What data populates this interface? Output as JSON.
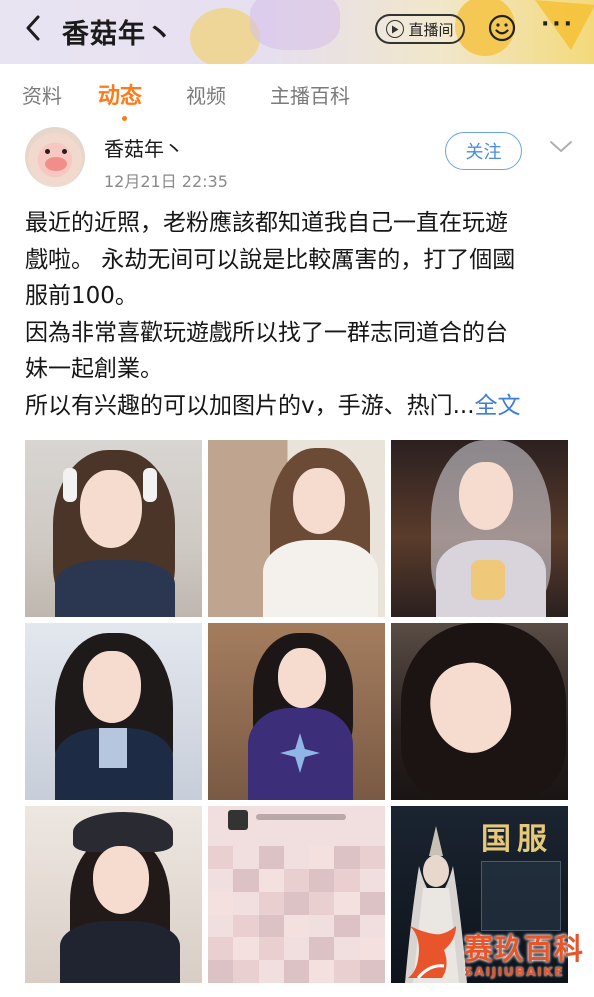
{
  "header": {
    "back_icon": "chevron-left-icon",
    "title": "香菇年丶",
    "live_button_label": "直播间",
    "emoji_icon": "smile-icon",
    "more_icon": "more-dots-icon",
    "more_label": "···"
  },
  "tabs": [
    {
      "label": "资料",
      "active": false
    },
    {
      "label": "动态",
      "active": true
    },
    {
      "label": "视频",
      "active": false
    },
    {
      "label": "主播百科",
      "active": false
    }
  ],
  "post": {
    "author": "香菇年丶",
    "time": "12月21日 22:35",
    "follow_label": "关注",
    "lines": [
      "最近的近照，老粉應該都知道我自己一直在玩遊",
      "戲啦。 永劫无间可以說是比較厲害的，打了個國",
      "服前100。",
      "因為非常喜歡玩遊戲所以找了一群志同道合的台",
      "妹一起創業。",
      "所以有兴趣的可以加图片的v，手游、热门..."
    ],
    "full_text_link": "全文",
    "photo_count": 9,
    "game_image_text": "国服"
  },
  "watermark": {
    "brand": "赛玖百科",
    "sub": "SAIJIUBAIKE",
    "color": "#e8552a"
  },
  "colors": {
    "accent": "#ff7a1a",
    "link": "#3f7ed6",
    "follow": "#4a8de0"
  }
}
